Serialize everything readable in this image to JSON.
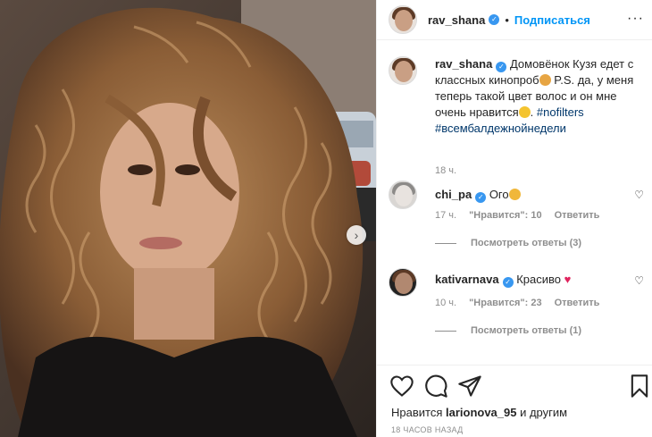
{
  "post": {
    "author": "rav_shana",
    "follow_label": "Подписаться",
    "separator": "•",
    "more_label": "···",
    "next_arrow": "›"
  },
  "caption": {
    "username": "rav_shana",
    "text_part1": "Домовёнок Кузя едет с классных кинопроб",
    "text_part2": " P.S. да, у меня теперь такой цвет волос и он мне очень нравится",
    "text_part3": ". ",
    "tag1": "#nofilters",
    "tag2": "#всембалдежнойнедели",
    "time": "18 ч."
  },
  "comments": [
    {
      "username": "chi_pa",
      "text": "Ого",
      "time": "17 ч.",
      "likes": "\"Нравится\": 10",
      "reply": "Ответить",
      "view_replies": "Посмотреть ответы (3)"
    },
    {
      "username": "kativarnava",
      "text": "Красиво",
      "time": "10 ч.",
      "likes": "\"Нравится\": 23",
      "reply": "Ответить",
      "view_replies": "Посмотреть ответы (1)"
    }
  ],
  "footer": {
    "likes_prefix": "Нравится ",
    "likes_user": "larionova_95",
    "likes_suffix": " и другим",
    "timestamp": "18 ЧАСОВ НАЗАД"
  },
  "icons": [
    "heart-icon",
    "comment-icon",
    "share-icon",
    "bookmark-icon",
    "verified-badge-icon",
    "next-arrow-icon"
  ]
}
